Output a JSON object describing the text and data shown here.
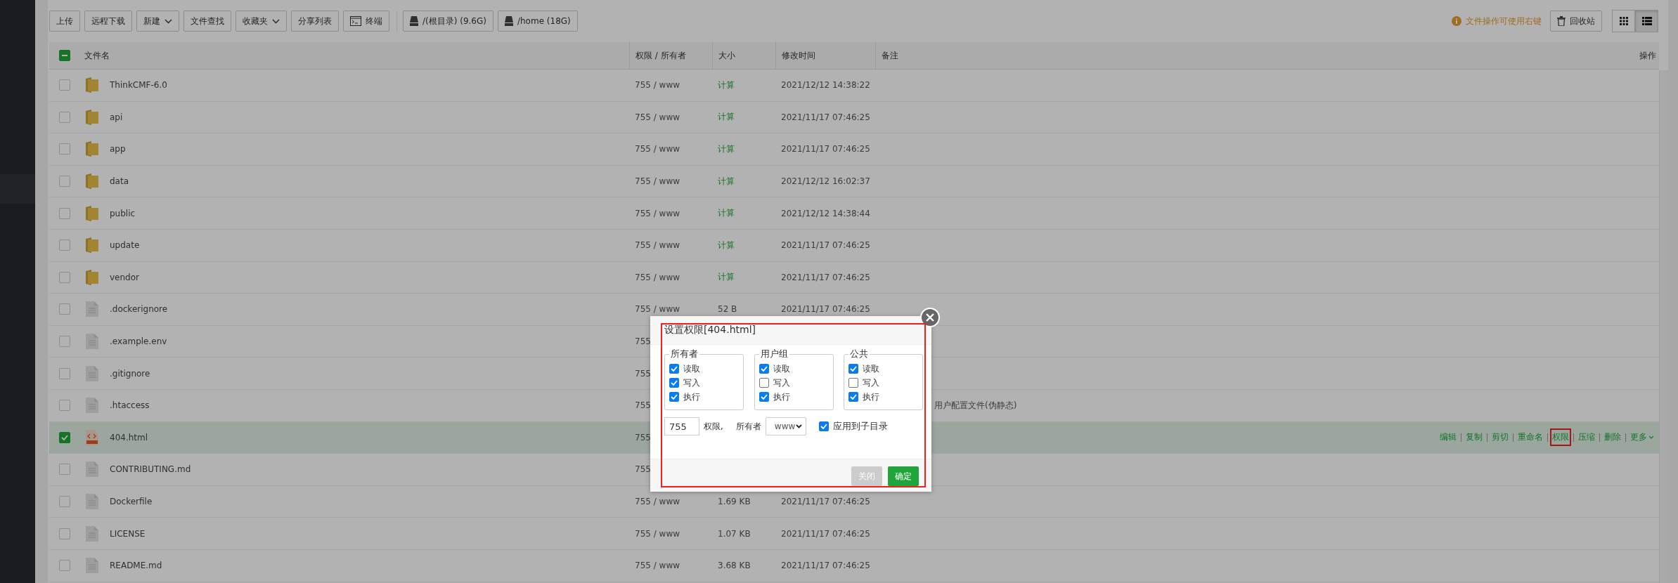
{
  "toolbar": {
    "buttons": [
      {
        "label": "上传",
        "kind": "plain"
      },
      {
        "label": "远程下载",
        "kind": "plain"
      },
      {
        "label": "新建",
        "kind": "dropdown"
      },
      {
        "label": "文件查找",
        "kind": "plain"
      },
      {
        "label": "收藏夹",
        "kind": "dropdown"
      },
      {
        "label": "分享列表",
        "kind": "plain"
      },
      {
        "label": "终端",
        "kind": "terminal"
      },
      {
        "label": "/(根目录) (9.6G)",
        "kind": "disk"
      },
      {
        "label": "/home (18G)",
        "kind": "disk"
      }
    ],
    "hint": "文件操作可使用右键",
    "recycle": "回收站",
    "views": [
      {
        "kind": "grid",
        "selected": false
      },
      {
        "kind": "list",
        "selected": true
      }
    ]
  },
  "table": {
    "partial": true,
    "columns": [
      "文件名",
      "权限 / 所有者",
      "大小",
      "修改时间",
      "备注",
      "操作"
    ],
    "rows": [
      {
        "kind": "folder",
        "name": "ThinkCMF-6.0",
        "perm": "755 / www",
        "size": "计算",
        "date": "2021/12/12 14:38:22",
        "selected": false
      },
      {
        "kind": "folder",
        "name": "api",
        "perm": "755 / www",
        "size": "计算",
        "date": "2021/11/17 07:46:25",
        "selected": false
      },
      {
        "kind": "folder",
        "name": "app",
        "perm": "755 / www",
        "size": "计算",
        "date": "2021/11/17 07:46:25",
        "selected": false
      },
      {
        "kind": "folder",
        "name": "data",
        "perm": "755 / www",
        "size": "计算",
        "date": "2021/12/12 16:02:37",
        "selected": false
      },
      {
        "kind": "folder",
        "name": "public",
        "perm": "755 / www",
        "size": "计算",
        "date": "2021/12/12 14:38:44",
        "selected": false
      },
      {
        "kind": "folder",
        "name": "update",
        "perm": "755 / www",
        "size": "计算",
        "date": "2021/11/17 07:46:25",
        "selected": false
      },
      {
        "kind": "folder",
        "name": "vendor",
        "perm": "755 / www",
        "size": "计算",
        "date": "2021/11/17 07:46:25",
        "selected": false
      },
      {
        "kind": "file",
        "name": ".dockerignore",
        "perm": "755 / www",
        "size": "52 B",
        "date": "2021/11/17 07:46:25",
        "selected": false
      },
      {
        "kind": "file",
        "name": ".example.env",
        "perm": "755",
        "selected": false
      },
      {
        "kind": "file",
        "name": ".gitignore",
        "perm": "755",
        "selected": false
      },
      {
        "kind": "file",
        "name": ".htaccess",
        "perm": "755",
        "remark": "用户配置文件(伪静态)",
        "selected": false
      },
      {
        "kind": "html",
        "name": "404.html",
        "perm": "755",
        "selected": true,
        "actions": [
          {
            "label": "编辑",
            "marked": false
          },
          {
            "label": "复制",
            "marked": false
          },
          {
            "label": "剪切",
            "marked": false
          },
          {
            "label": "重命名",
            "marked": false
          },
          {
            "label": "权限",
            "marked": true
          },
          {
            "label": "压缩",
            "marked": false
          },
          {
            "label": "删除",
            "marked": false
          },
          {
            "label": "更多",
            "marked": false,
            "kind": "dropdown"
          }
        ]
      },
      {
        "kind": "file",
        "name": "CONTRIBUTING.md",
        "perm": "755",
        "selected": false
      },
      {
        "kind": "file",
        "name": "Dockerfile",
        "perm": "755 / www",
        "size": "1.69 KB",
        "date": "2021/11/17 07:46:25",
        "selected": false
      },
      {
        "kind": "file",
        "name": "LICENSE",
        "perm": "755 / www",
        "size": "1.07 KB",
        "date": "2021/11/17 07:46:25",
        "selected": false
      },
      {
        "kind": "file",
        "name": "README.md",
        "perm": "755 / www",
        "size": "3.68 KB",
        "date": "2021/11/17 07:46:25",
        "selected": false
      }
    ]
  },
  "dialog": {
    "title": "设置权限[404.html]",
    "groups": [
      {
        "title": "所有者",
        "options": [
          {
            "label": "读取",
            "checked": true
          },
          {
            "label": "写入",
            "checked": true
          },
          {
            "label": "执行",
            "checked": true
          }
        ]
      },
      {
        "title": "用户组",
        "options": [
          {
            "label": "读取",
            "checked": true
          },
          {
            "label": "写入",
            "checked": false
          },
          {
            "label": "执行",
            "checked": true
          }
        ]
      },
      {
        "title": "公共",
        "options": [
          {
            "label": "读取",
            "checked": true
          },
          {
            "label": "写入",
            "checked": false
          },
          {
            "label": "执行",
            "checked": true
          }
        ]
      }
    ],
    "mode": "755",
    "mode_label": "权限,",
    "owner_label": "所有者",
    "owner": "www",
    "apply": {
      "label": "应用到子目录",
      "checked": true
    },
    "buttons": [
      {
        "label": "关闭",
        "kind": "cancel"
      },
      {
        "label": "确定",
        "kind": "confirm"
      }
    ]
  }
}
